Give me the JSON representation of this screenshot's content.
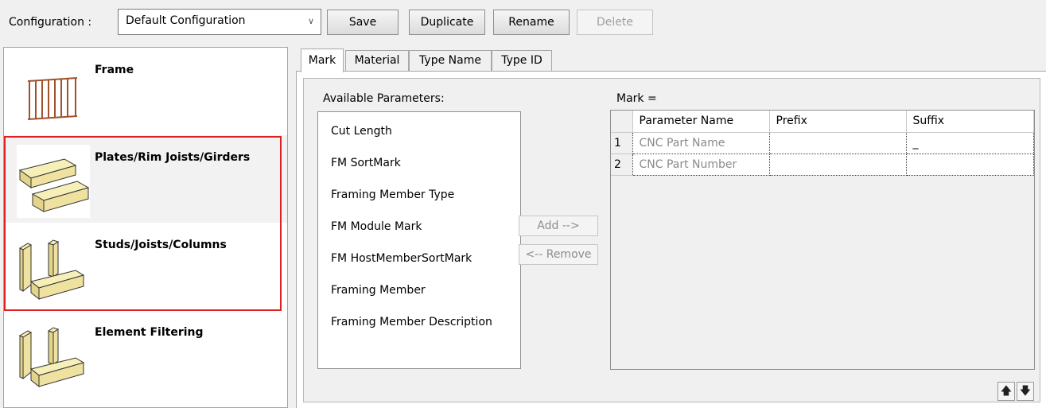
{
  "toolbar": {
    "config_label": "Configuration :",
    "config_value": "Default Configuration",
    "save_label": "Save",
    "duplicate_label": "Duplicate",
    "rename_label": "Rename",
    "delete_label": "Delete"
  },
  "sidebar": {
    "items": [
      {
        "label": "Frame",
        "icon": "frame-icon"
      },
      {
        "label": "Plates/Rim Joists/Girders",
        "icon": "plates-icon"
      },
      {
        "label": "Studs/Joists/Columns",
        "icon": "studs-icon"
      },
      {
        "label": "Element Filtering",
        "icon": "element-filtering-icon"
      }
    ],
    "highlight_color": "#e02020"
  },
  "tabs": [
    "Mark",
    "Material",
    "Type Name",
    "Type ID"
  ],
  "available": {
    "label": "Available Parameters:",
    "items": [
      "Cut Length",
      "FM SortMark",
      "Framing Member Type",
      "FM Module Mark",
      "FM HostMemberSortMark",
      "Framing Member",
      "Framing Member Description"
    ]
  },
  "actions": {
    "add_label": "Add -->",
    "remove_label": "<-- Remove"
  },
  "mark": {
    "label": "Mark =",
    "columns": [
      "Parameter Name",
      "Prefix",
      "Suffix"
    ],
    "rows": [
      {
        "num": "1",
        "param": "CNC Part Name",
        "prefix": "",
        "suffix": "_"
      },
      {
        "num": "2",
        "param": "CNC Part Number",
        "prefix": "",
        "suffix": ""
      }
    ]
  },
  "move": {
    "up_icon": "arrow-up-icon",
    "down_icon": "arrow-down-icon"
  }
}
